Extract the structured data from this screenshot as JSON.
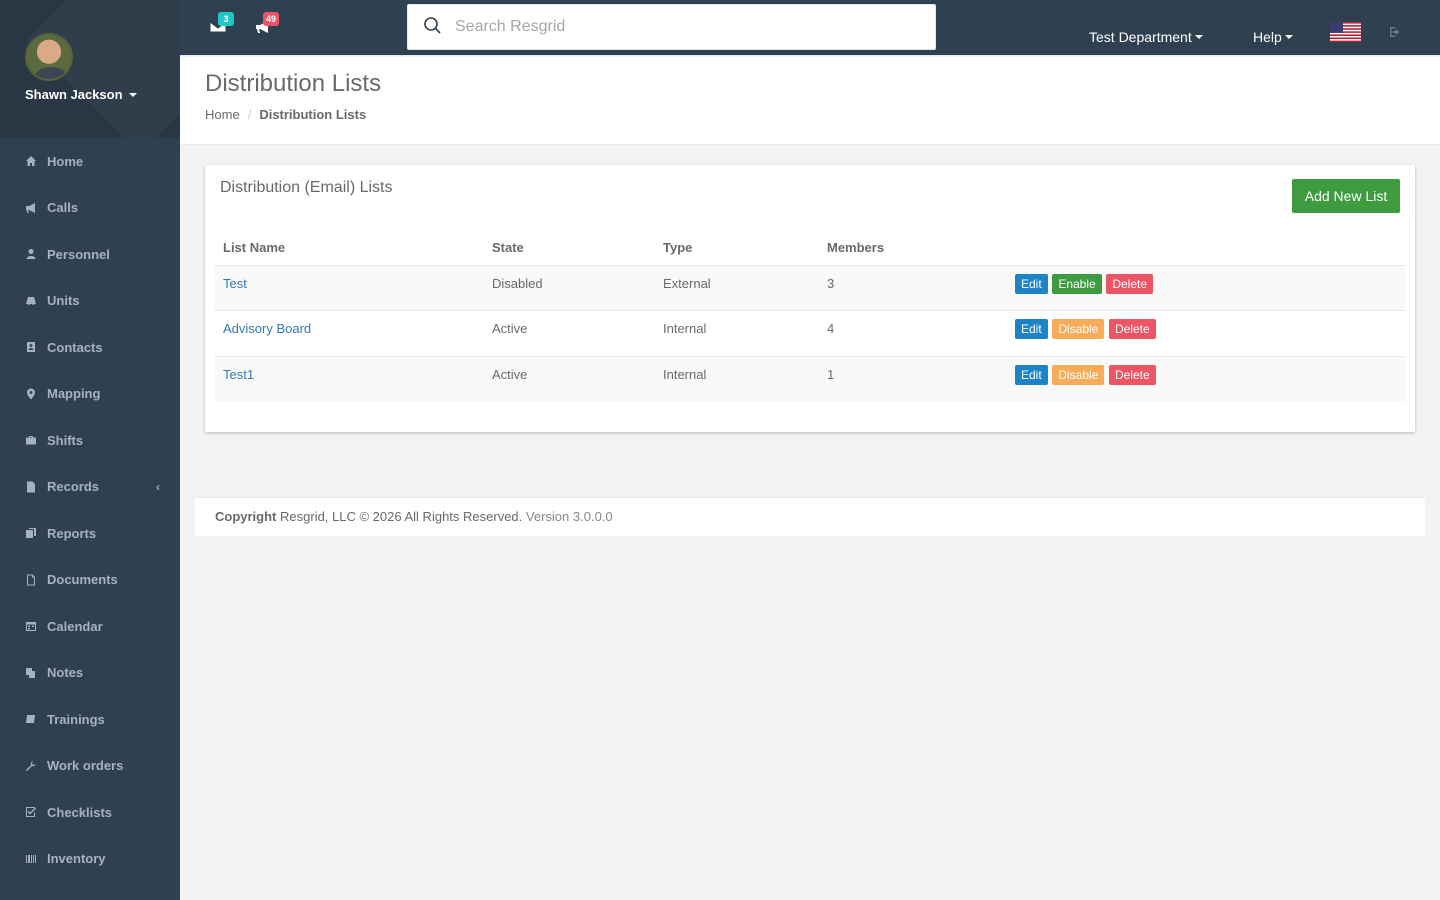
{
  "user": {
    "name": "Shawn Jackson"
  },
  "sidebar": {
    "items": [
      {
        "label": "Home",
        "icon": "home-icon"
      },
      {
        "label": "Calls",
        "icon": "bullhorn-icon"
      },
      {
        "label": "Personnel",
        "icon": "user-icon"
      },
      {
        "label": "Units",
        "icon": "truck-icon"
      },
      {
        "label": "Contacts",
        "icon": "contact-card-icon"
      },
      {
        "label": "Mapping",
        "icon": "map-marker-icon"
      },
      {
        "label": "Shifts",
        "icon": "briefcase-icon"
      },
      {
        "label": "Records",
        "icon": "file-icon"
      },
      {
        "label": "Reports",
        "icon": "report-icon"
      },
      {
        "label": "Documents",
        "icon": "document-icon"
      },
      {
        "label": "Calendar",
        "icon": "calendar-icon"
      },
      {
        "label": "Notes",
        "icon": "notes-icon"
      },
      {
        "label": "Trainings",
        "icon": "book-icon"
      },
      {
        "label": "Work orders",
        "icon": "wrench-icon"
      },
      {
        "label": "Checklists",
        "icon": "checklist-icon"
      },
      {
        "label": "Inventory",
        "icon": "barcode-icon"
      }
    ]
  },
  "topbar": {
    "messages_count": "3",
    "calls_count": "49",
    "search_placeholder": "Search Resgrid",
    "department_label": "Test Department",
    "help_label": "Help"
  },
  "header": {
    "title": "Distribution Lists",
    "breadcrumb": {
      "home": "Home",
      "current": "Distribution Lists"
    }
  },
  "panel": {
    "title": "Distribution (Email) Lists",
    "add_button": "Add New List",
    "columns": [
      "List Name",
      "State",
      "Type",
      "Members"
    ],
    "rows": [
      {
        "name": "Test",
        "state": "Disabled",
        "type": "External",
        "members": "3",
        "toggle": "Enable"
      },
      {
        "name": "Advisory Board",
        "state": "Active",
        "type": "Internal",
        "members": "4",
        "toggle": "Disable"
      },
      {
        "name": "Test1",
        "state": "Active",
        "type": "Internal",
        "members": "1",
        "toggle": "Disable"
      }
    ],
    "edit_label": "Edit",
    "delete_label": "Delete"
  },
  "footer": {
    "copyright_label": "Copyright",
    "copyright_text": "Resgrid, LLC © 2026 All Rights Reserved.",
    "version": "Version 3.0.0.0"
  },
  "colors": {
    "sidebar": "#2f4050",
    "primary": "#1c84c6",
    "success": "#3f9b3f",
    "warning": "#f8ac59",
    "danger": "#ed5565",
    "badge_info": "#23c6c8"
  }
}
